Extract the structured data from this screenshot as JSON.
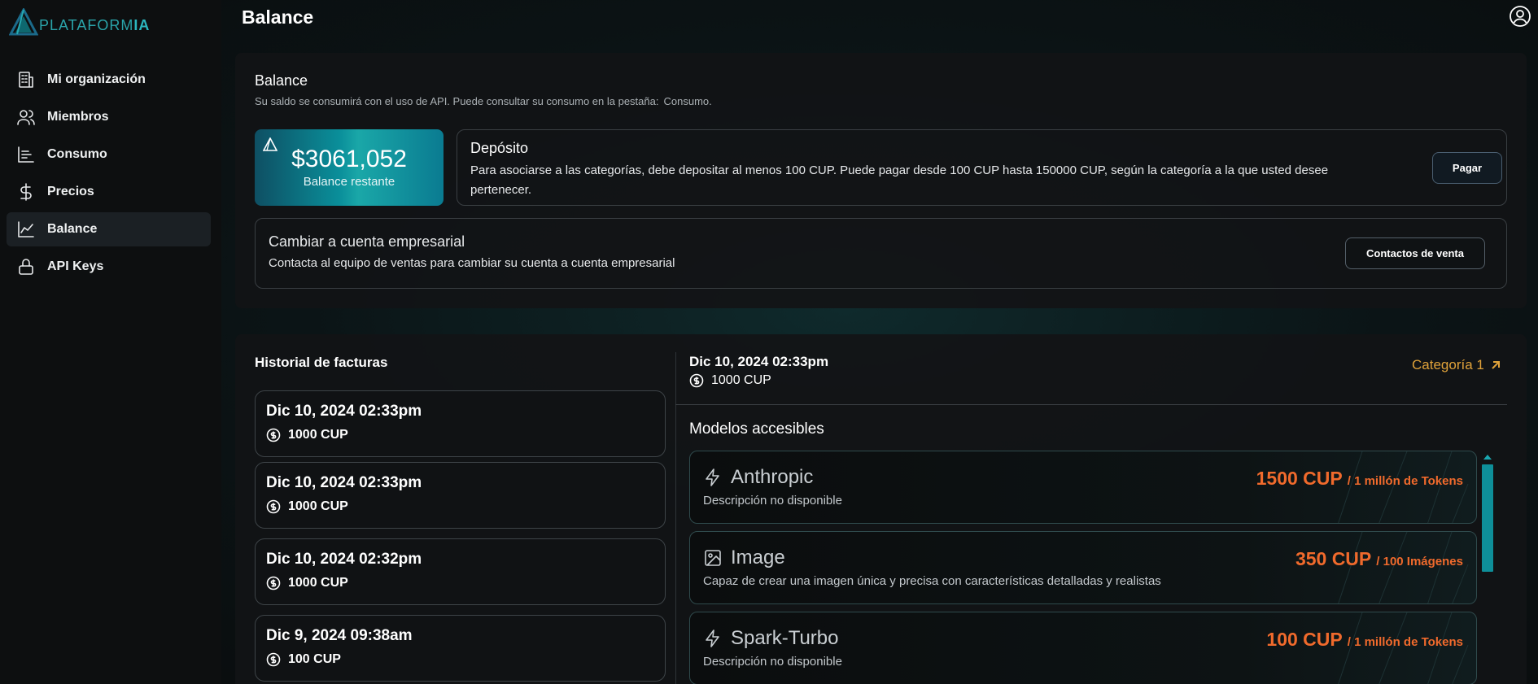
{
  "brand": {
    "name_prefix": "PLATAFORM",
    "name_suffix": "IA"
  },
  "page": {
    "title": "Balance"
  },
  "sidebar": {
    "items": [
      {
        "label": "Mi organización",
        "icon": "building-icon",
        "active": false
      },
      {
        "label": "Miembros",
        "icon": "users-icon",
        "active": false
      },
      {
        "label": "Consumo",
        "icon": "bar-chart-icon",
        "active": false
      },
      {
        "label": "Precios",
        "icon": "dollar-icon",
        "active": false
      },
      {
        "label": "Balance",
        "icon": "line-chart-icon",
        "active": true
      },
      {
        "label": "API Keys",
        "icon": "lock-icon",
        "active": false
      }
    ]
  },
  "balance_card": {
    "title": "Balance",
    "subtitle": "Su saldo se consumirá con el uso de API. Puede consultar su consumo en la pestaña:",
    "subtitle_link": "Consumo.",
    "amount": "$3061,052",
    "amount_label": "Balance restante",
    "deposit": {
      "title": "Depósito",
      "text": "Para asociarse a las categorías, debe depositar al menos 100 CUP. Puede pagar desde 100 CUP hasta 150000 CUP, según la categoría a la que usted desee pertenecer.",
      "button": "Pagar"
    },
    "enterprise": {
      "title": "Cambiar a cuenta empresarial",
      "text": "Contacta al equipo de ventas para cambiar su cuenta a cuenta empresarial",
      "button": "Contactos de venta"
    }
  },
  "history": {
    "title": "Historial de facturas",
    "invoices": [
      {
        "date": "Dic 10, 2024 02:33pm",
        "amount": "1000 CUP"
      },
      {
        "date": "Dic 10, 2024 02:33pm",
        "amount": "1000 CUP"
      },
      {
        "date": "Dic 10, 2024 02:32pm",
        "amount": "1000 CUP"
      },
      {
        "date": "Dic 9, 2024 09:38am",
        "amount": "100 CUP"
      }
    ]
  },
  "detail": {
    "date": "Dic 10, 2024 02:33pm",
    "amount": "1000 CUP",
    "category": "Categoría 1",
    "models_title": "Modelos accesibles",
    "models": [
      {
        "name": "Anthropic",
        "icon": "lightning-icon",
        "desc": "Descripción no disponible",
        "price": "1500 CUP",
        "unit": "/ 1 millón de Tokens"
      },
      {
        "name": "Image",
        "icon": "image-icon",
        "desc": "Capaz de crear una imagen única y precisa con características detalladas y realistas",
        "price": "350 CUP",
        "unit": "/ 100 Imágenes"
      },
      {
        "name": "Spark-Turbo",
        "icon": "lightning-icon",
        "desc": "Descripción no disponible",
        "price": "100 CUP",
        "unit": "/ 1 millón de Tokens"
      }
    ]
  },
  "colors": {
    "accent_teal": "#0e8f99",
    "price_orange": "#f06a2c",
    "category_gold": "#e0a23a"
  }
}
